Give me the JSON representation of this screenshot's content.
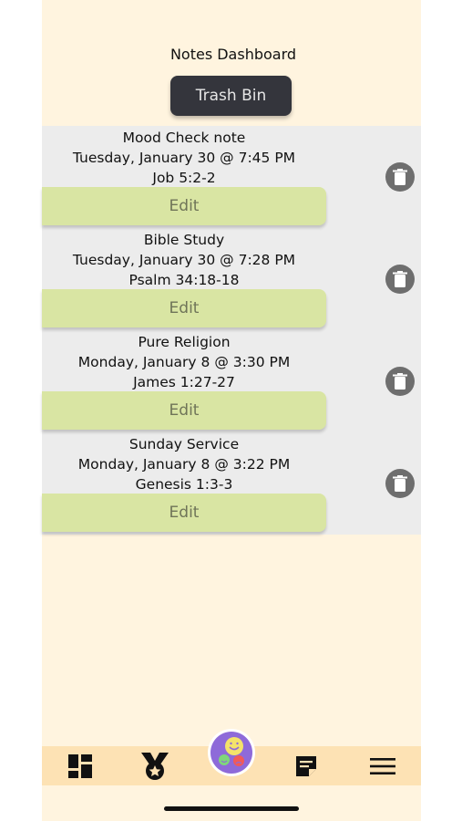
{
  "header": {
    "title": "Notes Dashboard"
  },
  "actions": {
    "trash_bin_label": "Trash Bin"
  },
  "notes": [
    {
      "title": "Mood Check note",
      "date": "Tuesday, January 30 @ 7:45 PM",
      "verse": "Job 5:2-2",
      "edit_label": "Edit"
    },
    {
      "title": "Bible Study",
      "date": "Tuesday, January 30 @ 7:28 PM",
      "verse": "Psalm 34:18-18",
      "edit_label": "Edit"
    },
    {
      "title": "Pure Religion",
      "date": "Monday, January 8 @ 3:30 PM",
      "verse": "James 1:27-27",
      "edit_label": "Edit"
    },
    {
      "title": "Sunday Service",
      "date": "Monday, January 8 @ 3:22 PM",
      "verse": "Genesis 1:3-3",
      "edit_label": "Edit"
    }
  ],
  "icons": {
    "delete": "trash-icon",
    "tabs": [
      "dashboard-icon",
      "medal-icon",
      "mood-faces-icon",
      "note-icon",
      "menu-icon"
    ]
  },
  "colors": {
    "background": "#fff4df",
    "notes_panel": "#ececec",
    "edit_button": "#d9e5a3",
    "trash_button": "#34353c",
    "tabbar": "#fde2b4",
    "mood_button": "#8e6ad9"
  }
}
